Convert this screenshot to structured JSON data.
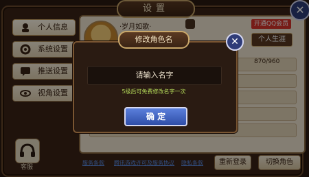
{
  "settings": {
    "title": "设置"
  },
  "sidebar": {
    "items": [
      {
        "label": "个人信息"
      },
      {
        "label": "系统设置"
      },
      {
        "label": "推送设置"
      },
      {
        "label": "视角设置"
      }
    ],
    "support_label": "客服"
  },
  "profile": {
    "nickname": "·岁月如歌·",
    "vip_label": "开通QQ会员",
    "career_label": "个人生涯",
    "progress": "870/960"
  },
  "footer": {
    "links": [
      "服务条款",
      "腾讯游戏许可及服务协议",
      "隐私条款"
    ],
    "relogin_label": "重新登录",
    "switch_label": "切换角色"
  },
  "modal": {
    "title": "修改角色名",
    "input_placeholder": "请输入名字",
    "hint": "5级后可免费修改名字一次",
    "confirm_label": "确 定"
  }
}
